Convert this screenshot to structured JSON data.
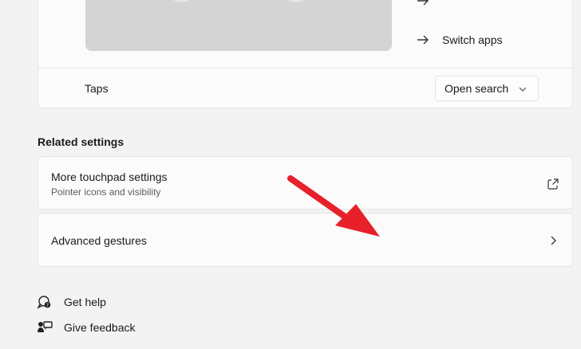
{
  "gestures": {
    "row_partial_label": "",
    "switch_apps_label": "Switch apps"
  },
  "taps": {
    "label": "Taps",
    "selected": "Open search"
  },
  "related": {
    "heading": "Related settings",
    "more_touchpad": {
      "title": "More touchpad settings",
      "subtitle": "Pointer icons and visibility"
    },
    "advanced_gestures": {
      "title": "Advanced gestures"
    }
  },
  "help": {
    "get_help": "Get help",
    "give_feedback": "Give feedback"
  },
  "colors": {
    "annotation_arrow": "#e8202a"
  }
}
